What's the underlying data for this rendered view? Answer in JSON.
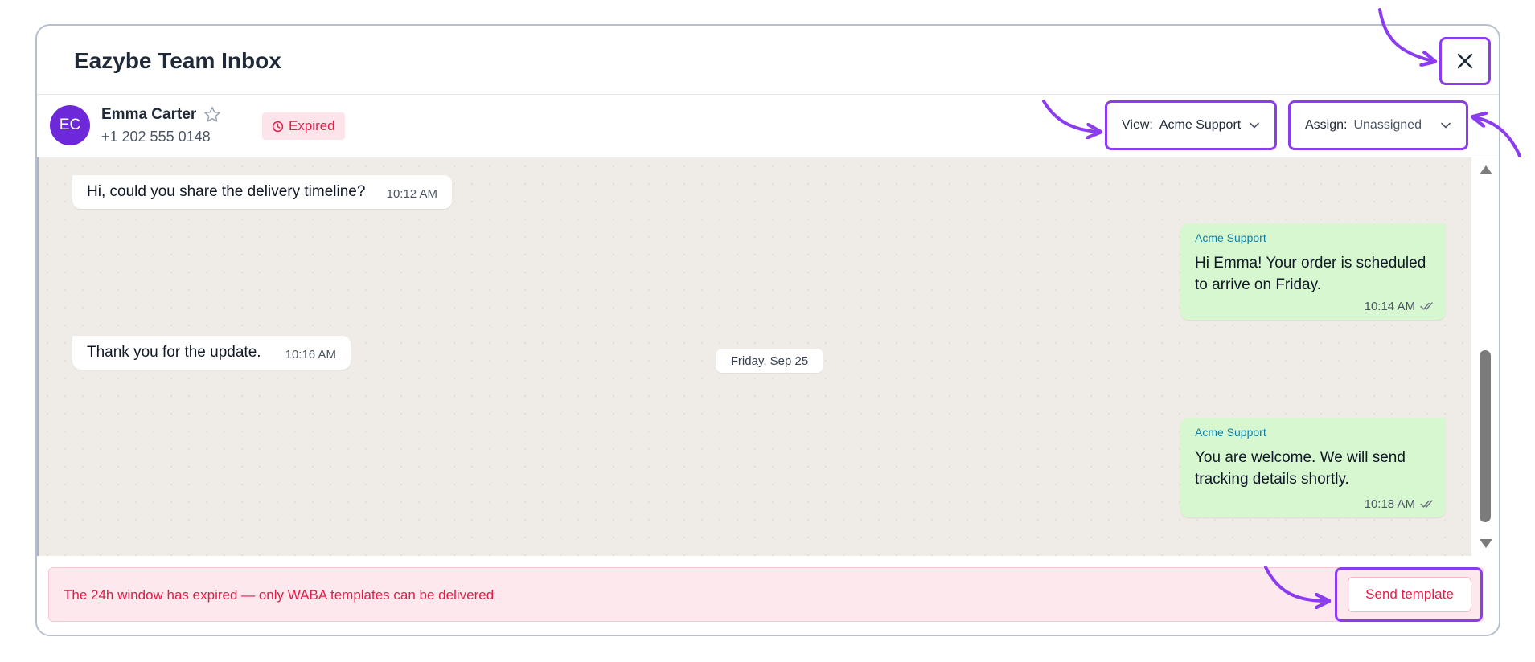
{
  "window": {
    "title": "Eazybe Team Inbox"
  },
  "contact": {
    "initials": "EC",
    "name": "Emma Carter",
    "phone": "+1 202 555 0148",
    "status_badge": "Expired"
  },
  "view_select": {
    "label": "View:",
    "value": "Acme Support"
  },
  "assign_select": {
    "label": "Assign:",
    "value": "Unassigned"
  },
  "messages": [
    {
      "direction": "incoming",
      "text": "Hi, could you share the delivery timeline?",
      "time": "10:12 AM"
    },
    {
      "direction": "outgoing",
      "sender": "Acme Support",
      "text": "Hi Emma! Your order is scheduled to arrive on Friday.",
      "time": "10:14 AM",
      "status": "read"
    },
    {
      "direction": "incoming",
      "text": "Thank you for the update.",
      "time": "10:16 AM"
    },
    {
      "direction": "outgoing",
      "sender": "Acme Support",
      "text": "You are welcome. We will send tracking details shortly.",
      "time": "10:18 AM",
      "status": "read"
    }
  ],
  "date_separator": "Friday, Sep 25",
  "footer": {
    "banner_text": "The 24h window has expired — only WABA templates can be delivered",
    "send_template_label": "Send template"
  },
  "icons": {
    "close": "close-icon",
    "star": "star-icon",
    "expired": "clock-icon",
    "chevron": "chevron-down-icon",
    "ticks": "double-check-icon"
  },
  "colors": {
    "accent": "#8b3cf0",
    "avatar": "#6d28d9",
    "danger": "#e11d48",
    "outgoing_bubble": "#d6f7cf",
    "chat_background": "#efebe6",
    "sender_name": "#0e7fa8"
  }
}
